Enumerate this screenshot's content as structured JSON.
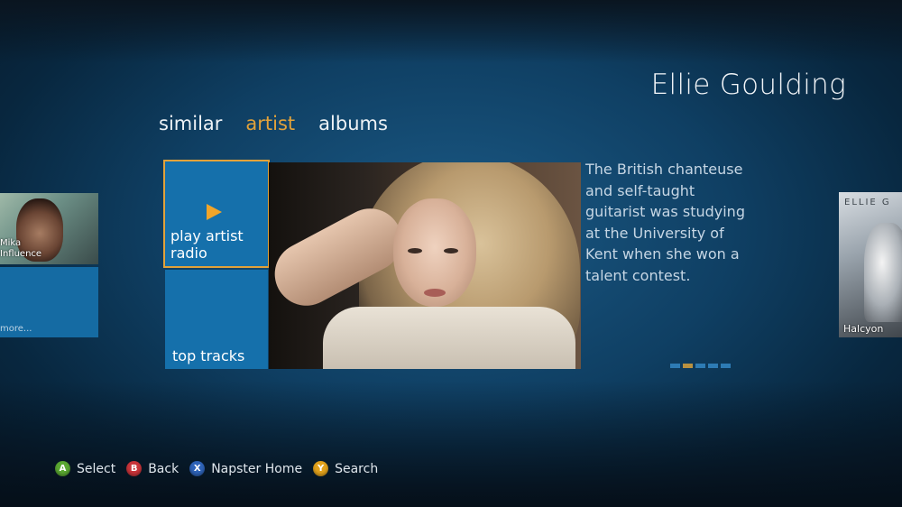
{
  "artist_name": "Ellie Goulding",
  "pivots": [
    {
      "label": "similar",
      "active": false
    },
    {
      "label": "artist",
      "active": true
    },
    {
      "label": "albums",
      "active": false
    }
  ],
  "left_card": {
    "name": "Mika",
    "subtitle": "Influence",
    "more_label": "more..."
  },
  "tiles": {
    "radio_label": "play artist radio",
    "top_tracks_label": "top tracks"
  },
  "bio": "The British chanteuse and self-taught guitarist was studying at the University of Kent when she won a talent contest.",
  "page_indicator": {
    "count": 5,
    "current_index": 1
  },
  "right_card": {
    "brand": "ELLIE G",
    "album": "Halcyon"
  },
  "hints": [
    {
      "key": "A",
      "label": "Select",
      "color": "#5aa832"
    },
    {
      "key": "B",
      "label": "Back",
      "color": "#c9343a"
    },
    {
      "key": "X",
      "label": "Napster Home",
      "color": "#2e63b8"
    },
    {
      "key": "Y",
      "label": "Search",
      "color": "#e2a21c"
    }
  ],
  "colors": {
    "accent": "#e2a23a",
    "tile": "#1570ab"
  }
}
